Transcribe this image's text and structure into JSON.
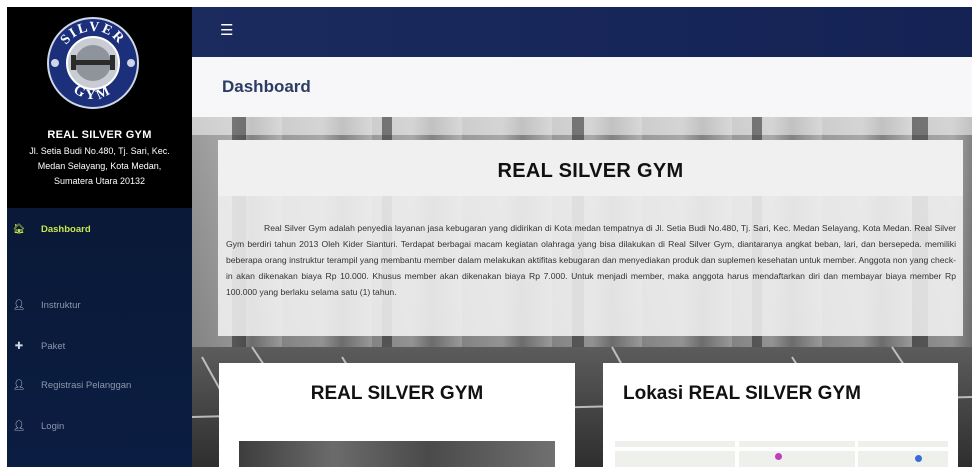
{
  "brand": {
    "logo_text_top": "SILVER",
    "logo_text_bottom": "GYM",
    "name": "REAL SILVER GYM",
    "address": "Jl. Setia Budi No.480, Tj. Sari, Kec.\nMedan Selayang, Kota Medan,\nSumatera Utara 20132"
  },
  "sidebar": {
    "items": [
      {
        "label": "Dashboard",
        "icon": "home-icon",
        "active": true
      },
      {
        "label": "Instruktur",
        "icon": "user-icon",
        "active": false
      },
      {
        "label": "Paket",
        "icon": "plus-icon",
        "active": false
      },
      {
        "label": "Registrasi Pelanggan",
        "icon": "user-icon",
        "active": false
      },
      {
        "label": "Login",
        "icon": "user-icon",
        "active": false
      }
    ]
  },
  "topbar": {
    "menu_icon": "hamburger-icon"
  },
  "page": {
    "title": "Dashboard"
  },
  "intro": {
    "title": "REAL SILVER GYM",
    "text": "Real Silver Gym adalah penyedia layanan jasa kebugaran yang didirikan di Kota medan tempatnya di Jl. Setia Budi No.480, Tj. Sari, Kec. Medan Selayang, Kota Medan. Real Silver Gym berdiri tahun 2013 Oleh Kider Sianturi. Terdapat berbagai macam kegiatan olahraga yang bisa dilakukan di Real Silver Gym, diantaranya angkat beban, lari, dan bersepeda. memiliki beberapa orang instruktur terampil yang membantu member dalam melakukan aktifitas kebugaran dan menyediakan produk dan suplemen kesehatan untuk member. Anggota non yang check-in akan dikenakan biaya Rp 10.000. Khusus member akan dikenakan biaya Rp 7.000. Untuk menjadi member, maka anggota harus mendaftarkan diri dan membayar biaya member Rp 100.000 yang berlaku selama satu (1) tahun."
  },
  "cards": {
    "left_title": "REAL SILVER GYM",
    "right_title": "Lokasi REAL SILVER GYM"
  },
  "colors": {
    "topbar": "#1b2b5e",
    "sidebar": "#0a1a3a",
    "active": "#c8e84a",
    "title": "#2c3d63"
  }
}
